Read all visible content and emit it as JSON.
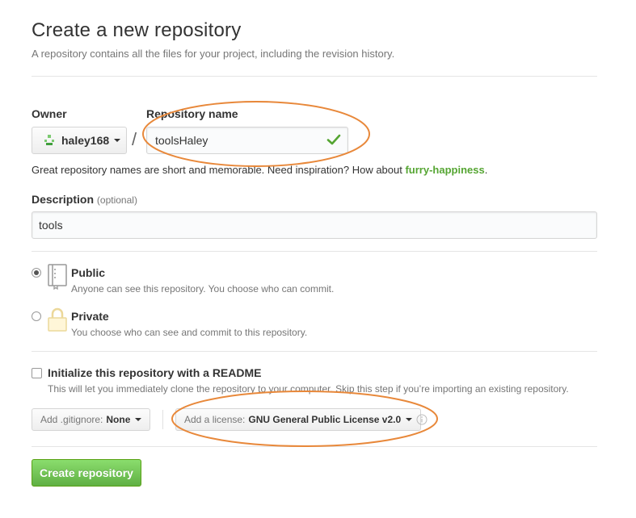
{
  "header": {
    "title": "Create a new repository",
    "subtitle": "A repository contains all the files for your project, including the revision history."
  },
  "form": {
    "owner_label": "Owner",
    "owner_value": "haley168",
    "separator": "/",
    "repo_name_label": "Repository name",
    "repo_name_value": "toolsHaley",
    "hint_text": "Great repository names are short and memorable. Need inspiration? How about ",
    "hint_suggestion": "furry-happiness",
    "hint_end": ".",
    "description_label": "Description",
    "description_optional": "(optional)",
    "description_value": "tools"
  },
  "visibility": {
    "selected": "Public",
    "options": [
      {
        "title": "Public",
        "desc": "Anyone can see this repository. You choose who can commit."
      },
      {
        "title": "Private",
        "desc": "You choose who can see and commit to this repository."
      }
    ]
  },
  "init": {
    "label": "Initialize this repository with a README",
    "desc": "This will let you immediately clone the repository to your computer. Skip this step if you’re importing an existing repository.",
    "checked": false
  },
  "gitignore": {
    "prefix": "Add .gitignore:",
    "value": "None"
  },
  "license": {
    "prefix": "Add a license:",
    "value": "GNU General Public License v2.0"
  },
  "create_button": "Create repository",
  "colors": {
    "accent_green": "#55a532",
    "button_green": "#60b044",
    "annotation_orange": "#e8883a"
  }
}
